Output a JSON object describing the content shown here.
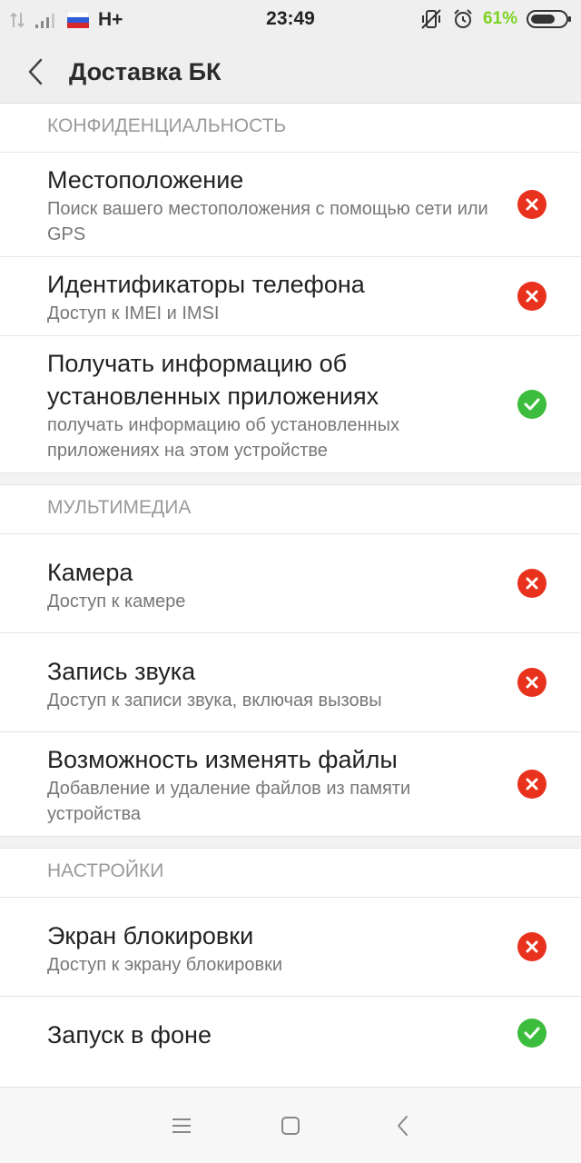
{
  "status_bar": {
    "network_type": "H+",
    "time": "23:49",
    "battery_percent": "61%",
    "battery_level": 0.61,
    "icons": [
      "data-transfer-icon",
      "signal-strength-icon",
      "russia-flag-icon",
      "vibrate-mode-icon",
      "alarm-icon",
      "battery-icon"
    ]
  },
  "header": {
    "title": "Доставка БК",
    "back_icon": "chevron-left-icon"
  },
  "colors": {
    "deny": "#e8321e",
    "allow": "#3dbd3d",
    "battery_text": "#7ed321"
  },
  "sections": [
    {
      "title": "КОНФИДЕНЦИАЛЬНОСТЬ",
      "items": [
        {
          "title": "Местоположение",
          "description": "Поиск вашего местоположения с помощью сети или GPS",
          "status": "denied"
        },
        {
          "title": "Идентификаторы телефона",
          "description": "Доступ к IMEI и IMSI",
          "status": "denied"
        },
        {
          "title": "Получать информацию об установленных приложениях",
          "description": "получать информацию об установленных приложениях на этом устройстве",
          "status": "allowed"
        }
      ]
    },
    {
      "title": "МУЛЬТИМЕДИА",
      "items": [
        {
          "title": "Камера",
          "description": "Доступ к камере",
          "status": "denied"
        },
        {
          "title": "Запись звука",
          "description": "Доступ к записи звука, включая вызовы",
          "status": "denied"
        },
        {
          "title": "Возможность изменять файлы",
          "description": "Добавление и удаление файлов из памяти устройства",
          "status": "denied"
        }
      ]
    },
    {
      "title": "НАСТРОЙКИ",
      "items": [
        {
          "title": "Экран блокировки",
          "description": "Доступ к экрану блокировки",
          "status": "denied"
        },
        {
          "title": "Запуск в фоне",
          "description": "",
          "status": "allowed"
        }
      ]
    }
  ],
  "nav_bar": {
    "buttons": [
      "menu-icon",
      "home-icon",
      "back-icon"
    ]
  }
}
